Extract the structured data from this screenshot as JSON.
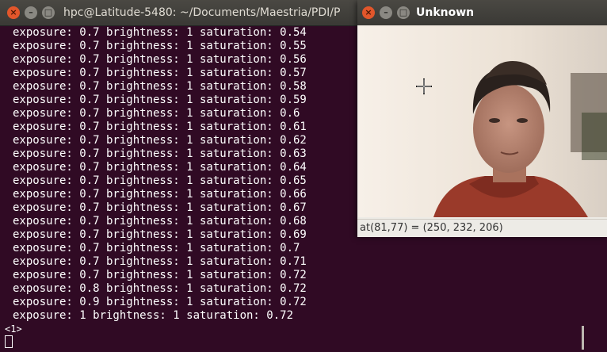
{
  "terminal": {
    "title": "hpc@Latitude-5480: ~/Documents/Maestria/PDI/P",
    "lines": [
      "exposure: 0.7 brightness: 1 saturation: 0.54",
      "exposure: 0.7 brightness: 1 saturation: 0.55",
      "exposure: 0.7 brightness: 1 saturation: 0.56",
      "exposure: 0.7 brightness: 1 saturation: 0.57",
      "exposure: 0.7 brightness: 1 saturation: 0.58",
      "exposure: 0.7 brightness: 1 saturation: 0.59",
      "exposure: 0.7 brightness: 1 saturation: 0.6",
      "exposure: 0.7 brightness: 1 saturation: 0.61",
      "exposure: 0.7 brightness: 1 saturation: 0.62",
      "exposure: 0.7 brightness: 1 saturation: 0.63",
      "exposure: 0.7 brightness: 1 saturation: 0.64",
      "exposure: 0.7 brightness: 1 saturation: 0.65",
      "exposure: 0.7 brightness: 1 saturation: 0.66",
      "exposure: 0.7 brightness: 1 saturation: 0.67",
      "exposure: 0.7 brightness: 1 saturation: 0.68",
      "exposure: 0.7 brightness: 1 saturation: 0.69",
      "exposure: 0.7 brightness: 1 saturation: 0.7",
      "exposure: 0.7 brightness: 1 saturation: 0.71",
      "exposure: 0.7 brightness: 1 saturation: 0.72",
      "exposure: 0.8 brightness: 1 saturation: 0.72",
      "exposure: 0.9 brightness: 1 saturation: 0.72",
      "exposure: 1 brightness: 1 saturation: 0.72"
    ],
    "prompt": "<1>",
    "colors": {
      "background": "#300a24",
      "text": "#ffffff"
    }
  },
  "image_window": {
    "title": "Unknown",
    "status": "at(81,77) = (250, 232, 206)"
  },
  "titlebar_buttons": {
    "close": "×",
    "minimize": "–",
    "maximize": "□"
  }
}
